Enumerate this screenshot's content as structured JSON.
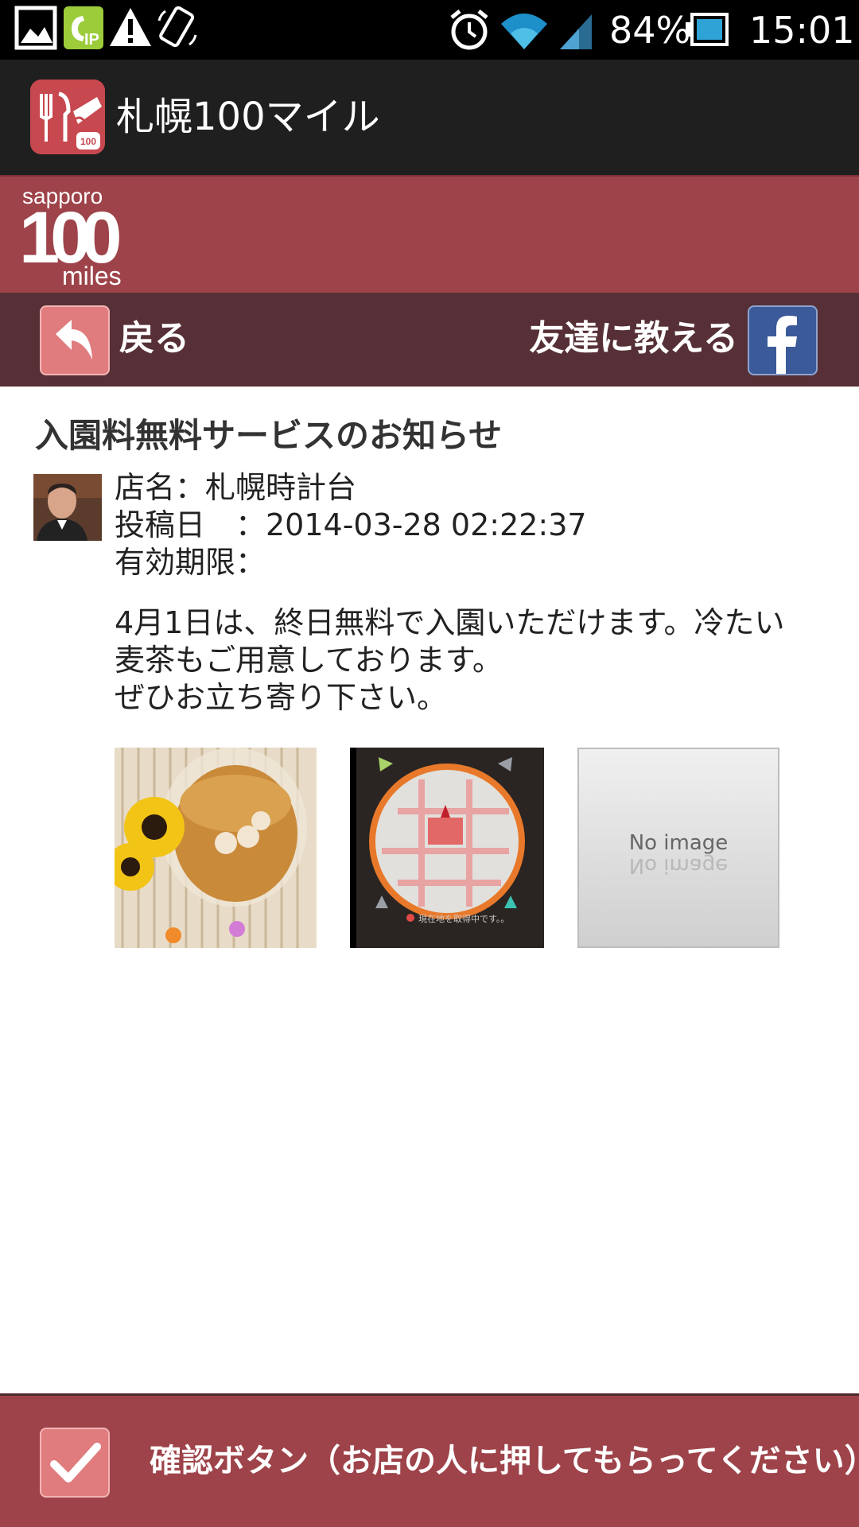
{
  "status_bar": {
    "battery": "84%",
    "time": "15:01",
    "icons": [
      "image-icon",
      "ip-phone-icon",
      "warning-icon",
      "rotate-icon",
      "alarm-icon",
      "wifi-icon",
      "signal-icon",
      "battery-icon"
    ]
  },
  "app_bar": {
    "title": "札幌100マイル"
  },
  "banner": {
    "logo_top": "sapporo",
    "logo_number": "100",
    "logo_bottom": "miles"
  },
  "nav": {
    "back_label": "戻る",
    "share_label": "友達に教える"
  },
  "post": {
    "title": "入園料無料サービスのお知らせ",
    "store_line": "店名：札幌時計台",
    "date_line": "投稿日　：2014-03-28 02:22:37",
    "expiry_line": "有効期限：",
    "body_lines": [
      "4月1日は、終日無料で入園いただけます。冷たい",
      "麦茶もご用意しております。",
      "ぜひお立ち寄り下さい。"
    ],
    "images": [
      {
        "name": "iced-tea-photo"
      },
      {
        "name": "map-screenshot",
        "caption": "現在地を取得中です。。"
      },
      {
        "name": "no-image-placeholder",
        "text": "No image"
      }
    ]
  },
  "confirm": {
    "label": "確認ボタン（お店の人に押してもらってください）"
  },
  "colors": {
    "brand": "#9e434a",
    "nav": "#563036",
    "facebook": "#3b5a9a",
    "button_pink": "#e07c7e"
  }
}
